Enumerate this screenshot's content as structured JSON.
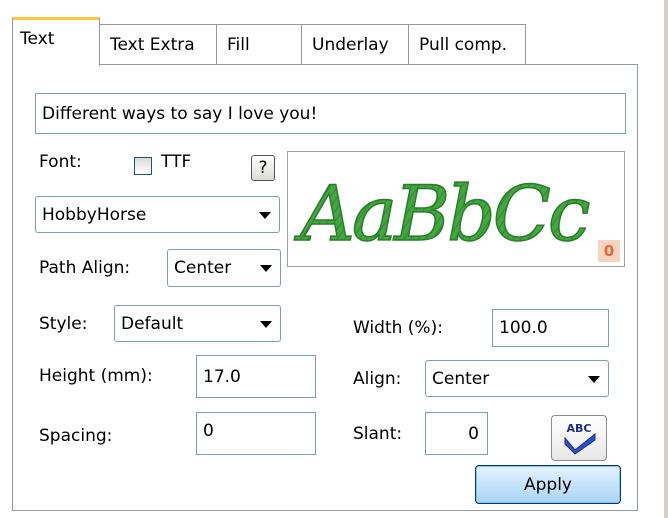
{
  "tabs": [
    {
      "label": "Text",
      "active": true
    },
    {
      "label": "Text Extra",
      "active": false
    },
    {
      "label": "Fill",
      "active": false
    },
    {
      "label": "Underlay",
      "active": false
    },
    {
      "label": "Pull comp.",
      "active": false
    }
  ],
  "text_input": {
    "value": "Different ways to say I love you!"
  },
  "font": {
    "label": "Font:",
    "ttf_label": "TTF",
    "ttf_checked": false,
    "help_label": "?",
    "selected": "HobbyHorse"
  },
  "path_align": {
    "label": "Path Align:",
    "selected": "Center"
  },
  "style": {
    "label": "Style:",
    "selected": "Default"
  },
  "height": {
    "label": "Height (mm):",
    "value": "17.0"
  },
  "spacing": {
    "label": "Spacing:",
    "value": "0"
  },
  "width": {
    "label": "Width (%):",
    "value": "100.0"
  },
  "align": {
    "label": "Align:",
    "selected": "Center"
  },
  "slant": {
    "label": "Slant:",
    "value": "0"
  },
  "preview": {
    "sample_text": "AaBbCc",
    "badge": "0",
    "sample_color": "#3fa83f",
    "badge_color": "#e8663a"
  },
  "spellcheck": {
    "icon_text": "ABC"
  },
  "apply": {
    "label": "Apply"
  },
  "colors": {
    "tab_highlight": "#ffc83c",
    "border": "#919b9c",
    "button_fill": "#a8d4f5"
  }
}
